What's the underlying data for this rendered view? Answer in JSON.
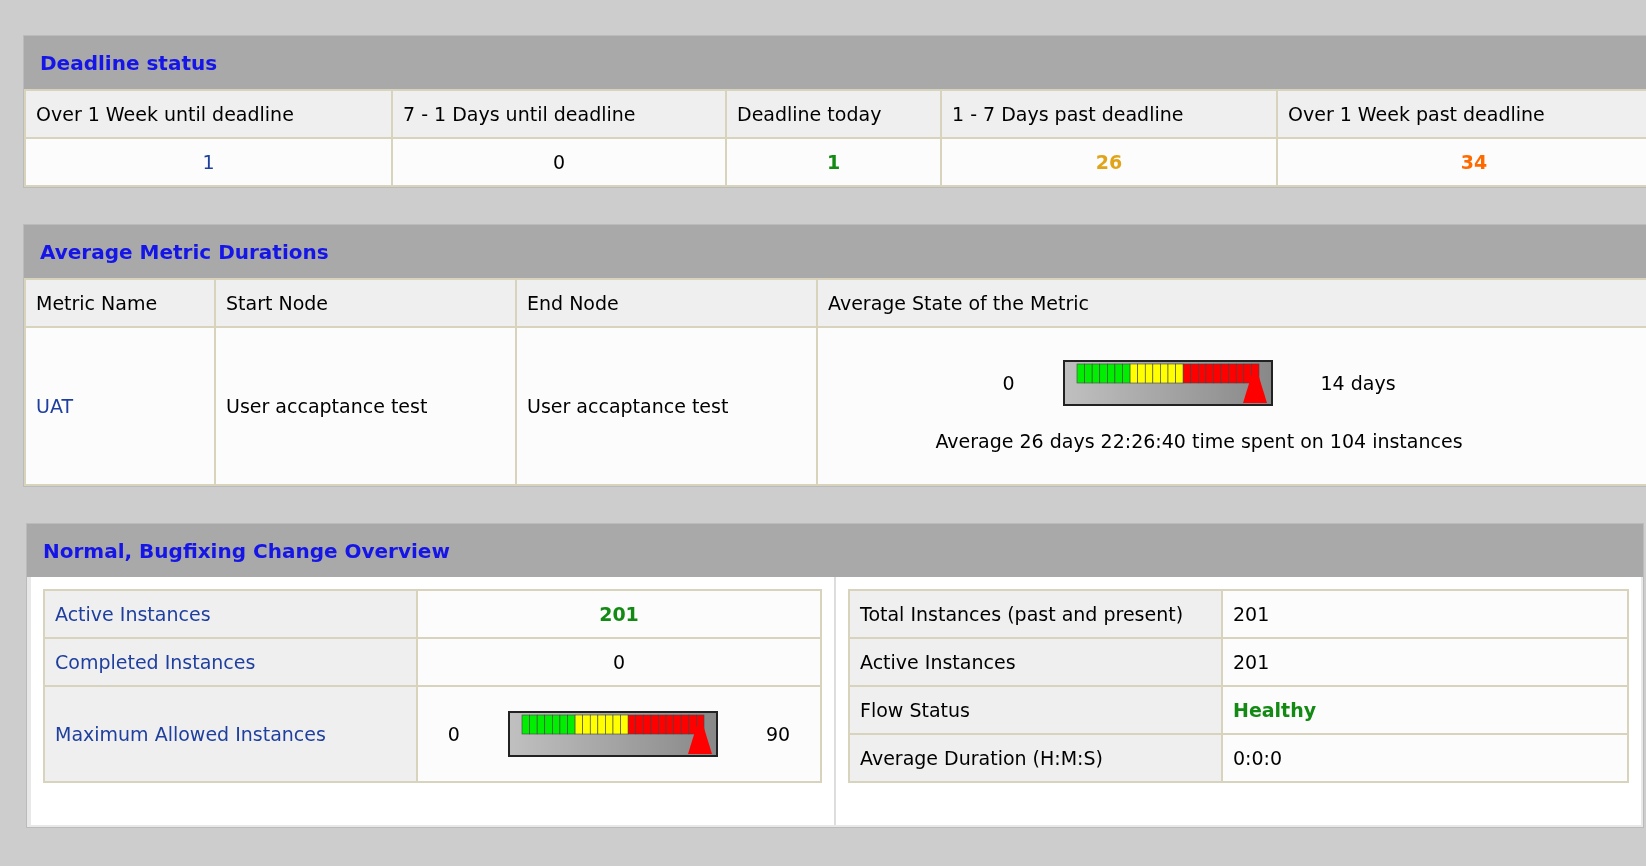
{
  "deadline_status": {
    "title": "Deadline status",
    "columns": [
      "Over 1 Week until deadline",
      "7 - 1 Days until deadline",
      "Deadline today",
      "1 - 7 Days past deadline",
      "Over 1 Week past deadline"
    ],
    "values": [
      {
        "text": "1",
        "color": "#1f3f9f",
        "bold": false
      },
      {
        "text": "0",
        "color": "#000000",
        "bold": false
      },
      {
        "text": "1",
        "color": "#138a13",
        "bold": true
      },
      {
        "text": "26",
        "color": "#e0a418",
        "bold": true
      },
      {
        "text": "34",
        "color": "#ff6a00",
        "bold": true
      }
    ]
  },
  "average_metric_durations": {
    "title": "Average Metric Durations",
    "columns": [
      "Metric Name",
      "Start Node",
      "End Node",
      "Average State of the Metric"
    ],
    "rows": [
      {
        "metric_name": "UAT",
        "start_node": "User accaptance test",
        "end_node": "User accaptance test",
        "gauge": {
          "min": "0",
          "max": "14 days",
          "level": 1
        },
        "summary": "Average 26 days 22:26:40 time spent on 104 instances"
      }
    ]
  },
  "change_overview": {
    "title": "Normal, Bugfixing Change Overview",
    "left": [
      {
        "kind": "value",
        "label": "Active Instances",
        "value": "201",
        "color": "#138a13",
        "bold": true
      },
      {
        "kind": "value",
        "label": "Completed Instances",
        "value": "0",
        "color": "#000000",
        "bold": false
      },
      {
        "kind": "gauge",
        "label": "Maximum Allowed Instances",
        "min": "0",
        "max": "90",
        "level": 1
      }
    ],
    "right": [
      {
        "label": "Total Instances (past and present)",
        "value": "201",
        "color": "#000000",
        "bold": false
      },
      {
        "label": "Active Instances",
        "value": "201",
        "color": "#000000",
        "bold": false
      },
      {
        "label": "Flow Status",
        "value": "Healthy",
        "color": "#138a13",
        "bold": true
      },
      {
        "label": "Average Duration (H:M:S)",
        "value": "0:0:0",
        "color": "#000000",
        "bold": false
      }
    ]
  }
}
